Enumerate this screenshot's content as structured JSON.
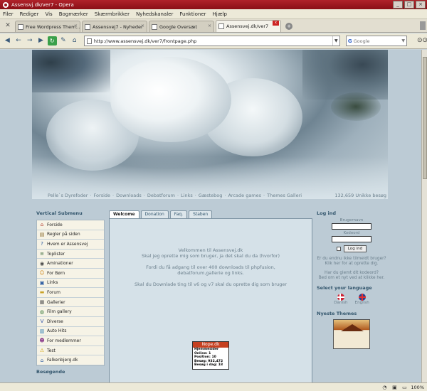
{
  "window": {
    "title": "Assensvj.dk/ver7 - Opera"
  },
  "menu": [
    "Filer",
    "Rediger",
    "Vis",
    "Bogmærker",
    "Skærmbrikker",
    "Nyhedskanaler",
    "Funktioner",
    "Hjælp"
  ],
  "tabs": [
    {
      "label": "Free Wordpress Them..."
    },
    {
      "label": "Assensvej7 - Nyheder"
    },
    {
      "label": "Google Oversæt"
    },
    {
      "label": "Assensvej.dk/ver7"
    }
  ],
  "address": {
    "url": "http://www.assensvej.dk/ver7/frontpage.php",
    "search_placeholder": "Google"
  },
  "site": {
    "nav": [
      "Pelle`s Dyrefoder",
      "Forside",
      "Downloads",
      "Debatforum",
      "Links",
      "Gæstebog",
      "Arcade games",
      "Themes Galleri"
    ],
    "visits": "132,659 Unikke besøg",
    "left_title": "Vertical Submenu",
    "left_items": [
      {
        "label": "Forside",
        "icon": "house-icon"
      },
      {
        "label": "Regler på siden",
        "icon": "scroll-icon"
      },
      {
        "label": "Hvem er Assensvej",
        "icon": "question-icon"
      },
      {
        "label": "Toplister",
        "icon": "list-icon"
      },
      {
        "label": "Aminationer",
        "icon": "film-icon"
      },
      {
        "label": "For Børn",
        "icon": "child-icon"
      },
      {
        "label": "Links",
        "icon": "link-icon"
      },
      {
        "label": "Forum",
        "icon": "folder-icon"
      },
      {
        "label": "Gallerier",
        "icon": "picture-icon"
      },
      {
        "label": "Film gallery",
        "icon": "camera-icon"
      },
      {
        "label": "Diverse",
        "icon": "sheet-icon"
      },
      {
        "label": "Auto Hits",
        "icon": "chart-icon"
      },
      {
        "label": "For medlemmer",
        "icon": "members-icon"
      },
      {
        "label": "Test",
        "icon": "warning-icon"
      },
      {
        "label": "Falkenbjerg.dk",
        "icon": "home-icon"
      }
    ],
    "left_sub2": "Besøgende",
    "center_tabs": [
      "Welcome",
      "Donation",
      "Faq.",
      "Staben"
    ],
    "welcome": [
      "Velkommen til Assensvej.dk",
      "Skal jeg oprette mig som bruger, ja det skal du da (hvorfor)",
      "Fordi du få adgang til over 400 downloads til phpfusion,",
      "debatforum,gallerie og links.",
      "Skal du Downlade ting til v6 og v7 skal du oprette dig som bruger"
    ],
    "nope": {
      "title": "Nope.dk",
      "rows": [
        "Hjemmesider",
        "Online:   1",
        "Position:   10",
        "Besøg:   932,472",
        "Besøg i dag:   18"
      ]
    },
    "login": {
      "title": "Log ind",
      "username_label": "Brugernavn",
      "password_label": "Kodeord",
      "button": "Log ind",
      "not_member": "Er du endnu ikke tilmeldt bruger?",
      "signup": "Klik her for at oprette dig.",
      "forgot_q": "Har du glemt dit kodeord?",
      "forgot_a": "Bed om et nyt ved at klikke her."
    },
    "language": {
      "title": "Select your language",
      "options": [
        "Danish",
        "English"
      ]
    },
    "themes_title": "Nyeste Themes"
  },
  "status": {
    "zoom": "100%"
  },
  "colors": {
    "titlebar": "#a0181f",
    "accent": "#34576e",
    "site_bg": "#bccbd5"
  }
}
